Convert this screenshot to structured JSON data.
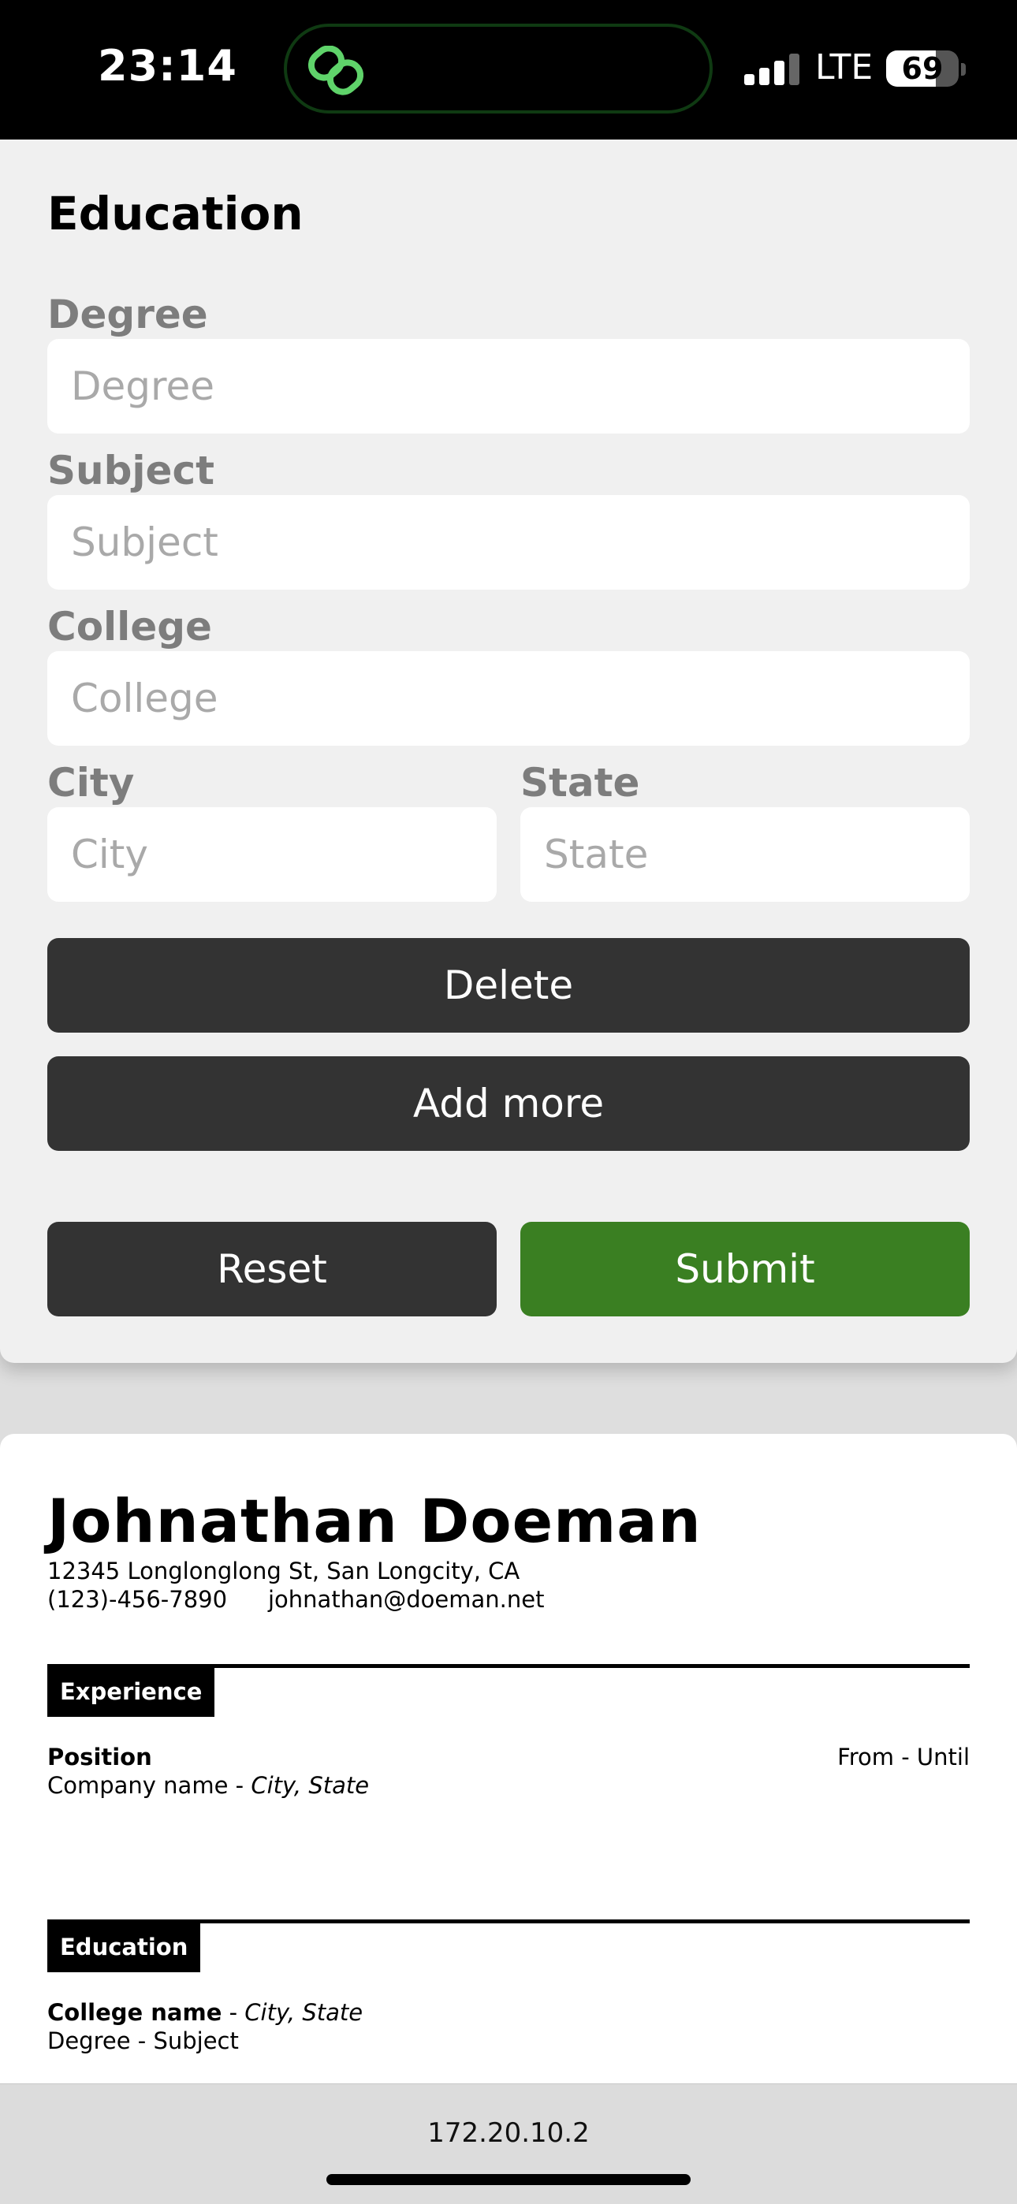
{
  "status_bar": {
    "time": "23:14",
    "network": "LTE",
    "battery": "69",
    "battery_level": 0.69
  },
  "form": {
    "section_title": "Education",
    "fields": {
      "degree": {
        "label": "Degree",
        "placeholder": "Degree",
        "value": ""
      },
      "subject": {
        "label": "Subject",
        "placeholder": "Subject",
        "value": ""
      },
      "college": {
        "label": "College",
        "placeholder": "College",
        "value": ""
      },
      "city": {
        "label": "City",
        "placeholder": "City",
        "value": ""
      },
      "state": {
        "label": "State",
        "placeholder": "State",
        "value": ""
      }
    },
    "buttons": {
      "delete": "Delete",
      "add_more": "Add more",
      "reset": "Reset",
      "submit": "Submit"
    }
  },
  "resume": {
    "name": "Johnathan Doeman",
    "address": "12345 Longlonglong St, San Longcity, CA",
    "phone": "(123)-456-7890",
    "email": "johnathan@doeman.net",
    "experience": {
      "heading": "Experience",
      "position": "Position",
      "dates": "From - Until",
      "company": "Company name",
      "separator": " - ",
      "location": "City, State"
    },
    "education": {
      "heading": "Education",
      "college": "College name",
      "separator": " - ",
      "location": "City, State",
      "degree_subject": "Degree - Subject"
    }
  },
  "browser": {
    "url": "172.20.10.2"
  },
  "colors": {
    "accent": "#3a7f22",
    "button_dark": "#333333",
    "form_bg": "#f0f0f0"
  }
}
